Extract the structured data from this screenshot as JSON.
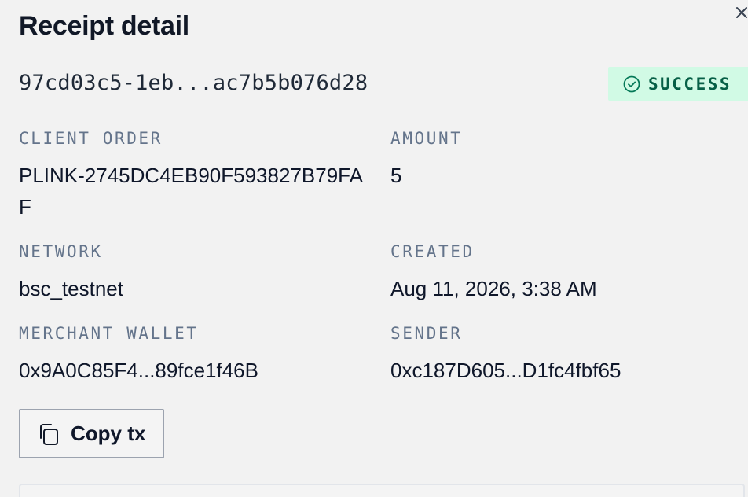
{
  "panel": {
    "title": "Receipt detail",
    "tx_id": "97cd03c5-1eb...ac7b5b076d28",
    "status": {
      "label": "SUCCESS",
      "color": "#065f46",
      "background": "#d1fae5"
    }
  },
  "fields": {
    "client_order": {
      "label": "CLIENT ORDER",
      "value": "PLINK-2745DC4EB90F593827B79FAF"
    },
    "amount": {
      "label": "AMOUNT",
      "value": "5"
    },
    "network": {
      "label": "NETWORK",
      "value": "bsc_testnet"
    },
    "created": {
      "label": "CREATED",
      "value": "Aug 11, 2026, 3:38 AM"
    },
    "merchant_wallet": {
      "label": "MERCHANT WALLET",
      "value": "0x9A0C85F4...89fce1f46B"
    },
    "sender": {
      "label": "SENDER",
      "value": "0xc187D605...D1fc4fbf65"
    }
  },
  "actions": {
    "copy_tx_label": "Copy tx"
  },
  "icons": {
    "close": "close-icon",
    "status": "check-circle-icon",
    "copy": "copy-icon"
  }
}
